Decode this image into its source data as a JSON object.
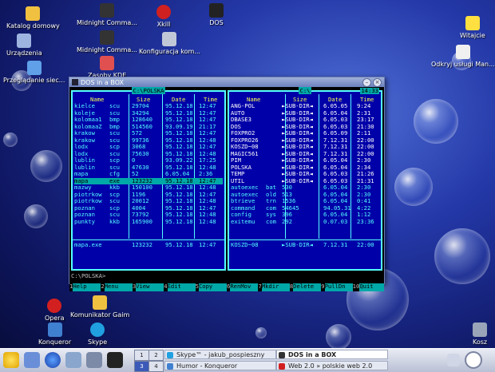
{
  "desktop": {
    "icons": [
      {
        "label": "Katalog domowy",
        "icon": "home-icon"
      },
      {
        "label": "Urządzenia",
        "icon": "computer-icon"
      },
      {
        "label": "Przeglądanie siec...",
        "icon": "network-icon"
      },
      {
        "label": "Midnight Comma...",
        "icon": "terminal-icon"
      },
      {
        "label": "Midnight Comma...",
        "icon": "terminal-icon"
      },
      {
        "label": "Zasoby KDE",
        "icon": "kde-resources-icon"
      },
      {
        "label": "Xkill",
        "icon": "xkill-icon"
      },
      {
        "label": "Konfiguracja kom...",
        "icon": "settings-icon"
      },
      {
        "label": "DOS",
        "icon": "dos-icon"
      },
      {
        "label": "Witajcie",
        "icon": "star-icon"
      },
      {
        "label": "Odkryj usługi Man...",
        "icon": "mandriva-icon"
      },
      {
        "label": "Opera",
        "icon": "opera-icon"
      },
      {
        "label": "Komunikator Gaim",
        "icon": "gaim-icon"
      },
      {
        "label": "Konqueror",
        "icon": "konqueror-icon"
      },
      {
        "label": "Skype",
        "icon": "skype-icon"
      },
      {
        "label": "Kosz",
        "icon": "trash-icon"
      }
    ]
  },
  "window": {
    "title": "DOS in a BOX",
    "buttons": [
      "minimize",
      "close"
    ]
  },
  "left_panel": {
    "path": "C:\\POLSKA",
    "headers": [
      "Name",
      "Size",
      "Date",
      "Time"
    ],
    "rows": [
      {
        "name": "kielce",
        "ext": "scu",
        "size": "29704",
        "date": "95.12.18",
        "time": "12:47"
      },
      {
        "name": "koleje",
        "ext": "scu",
        "size": "34294",
        "date": "95.12.18",
        "time": "12:47"
      },
      {
        "name": "kolomaa1",
        "ext": "bmp",
        "size": "128640",
        "date": "95.12.18",
        "time": "12:47"
      },
      {
        "name": "kolomaaZ",
        "ext": "bmp",
        "size": "514560",
        "date": "93.09.19",
        "time": "21:17"
      },
      {
        "name": "krakow",
        "ext": "scu",
        "size": "572",
        "date": "95.12.18",
        "time": "12:47"
      },
      {
        "name": "krakow",
        "ext": "scu",
        "size": "99736",
        "date": "95.12.18",
        "time": "12:48"
      },
      {
        "name": "lodx",
        "ext": "scp",
        "size": "3068",
        "date": "95.12.18",
        "time": "12:47"
      },
      {
        "name": "lodx",
        "ext": "scu",
        "size": "75630",
        "date": "95.12.18",
        "time": "12:48"
      },
      {
        "name": "lublin",
        "ext": "scp",
        "size": "0",
        "date": "93.09.22",
        "time": "17:25"
      },
      {
        "name": "lublin",
        "ext": "scu",
        "size": "47630",
        "date": "95.12.18",
        "time": "12:48"
      },
      {
        "name": "mapa",
        "ext": "cfg",
        "size": "52",
        "date": "6.05.04",
        "time": "2:36"
      },
      {
        "name": "mapa",
        "ext": "exe",
        "size": "123232",
        "date": "95.12.18",
        "time": "12:47",
        "selected": true
      },
      {
        "name": "mazwy",
        "ext": "kkb",
        "size": "150100",
        "date": "95.12.18",
        "time": "12:48"
      },
      {
        "name": "piotrkow",
        "ext": "scp",
        "size": "1196",
        "date": "95.12.18",
        "time": "12:47"
      },
      {
        "name": "piotrkow",
        "ext": "scu",
        "size": "20012",
        "date": "95.12.18",
        "time": "12:48"
      },
      {
        "name": "poznan",
        "ext": "scp",
        "size": "4004",
        "date": "95.12.18",
        "time": "12:47"
      },
      {
        "name": "poznan",
        "ext": "scu",
        "size": "73792",
        "date": "95.12.18",
        "time": "12:48"
      },
      {
        "name": "punkty",
        "ext": "kkb",
        "size": "165900",
        "date": "95.12.18",
        "time": "12:48"
      }
    ],
    "info": {
      "name": "mapa.exe",
      "size": "123232",
      "date": "95.12.18",
      "time": "12:47"
    }
  },
  "right_panel": {
    "path": "C:\\",
    "clock": "14:33",
    "headers": [
      "Name",
      "Size",
      "Date",
      "Time"
    ],
    "rows": [
      {
        "name": "ANG-POL",
        "ext": "",
        "size": "►SUB-DIR◄",
        "date": "6.05.05",
        "time": "9:24",
        "dir": true
      },
      {
        "name": "AUTO",
        "ext": "",
        "size": "►SUB-DIR◄",
        "date": "6.05.04",
        "time": "2:31",
        "dir": true
      },
      {
        "name": "DBASE3",
        "ext": "",
        "size": "►SUB-DIR◄",
        "date": "6.05.03",
        "time": "23:17",
        "dir": true
      },
      {
        "name": "DOS",
        "ext": "",
        "size": "►SUB-DIR◄",
        "date": "6.05.03",
        "time": "21:30",
        "dir": true
      },
      {
        "name": "FOXPRO2",
        "ext": "",
        "size": "►SUB-DIR◄",
        "date": "6.05.09",
        "time": "2:11",
        "dir": true
      },
      {
        "name": "FOXPRO26",
        "ext": "",
        "size": "►SUB-DIR◄",
        "date": "7.12.31",
        "time": "22:00",
        "dir": true
      },
      {
        "name": "KOSZD~08",
        "ext": "",
        "size": "►SUB-DIR◄",
        "date": "7.12.31",
        "time": "22:00",
        "dir": true
      },
      {
        "name": "MAGIC561",
        "ext": "",
        "size": "►SUB-DIR◄",
        "date": "7.12.31",
        "time": "22:00",
        "dir": true
      },
      {
        "name": "PIM",
        "ext": "",
        "size": "►SUB-DIR◄",
        "date": "6.05.04",
        "time": "2:30",
        "dir": true
      },
      {
        "name": "POLSKA",
        "ext": "",
        "size": "►SUB-DIR◄",
        "date": "6.05.04",
        "time": "2:34",
        "dir": true
      },
      {
        "name": "TEMP",
        "ext": "",
        "size": "►SUB-DIR◄",
        "date": "6.05.03",
        "time": "21:26",
        "dir": true
      },
      {
        "name": "UTIL",
        "ext": "",
        "size": "►SUB-DIR◄",
        "date": "6.05.03",
        "time": "21:31",
        "dir": true
      },
      {
        "name": "autoexec",
        "ext": "bat",
        "size": "530",
        "date": "6.05.04",
        "time": "2:30"
      },
      {
        "name": "autoexec",
        "ext": "old",
        "size": "513",
        "date": "6.05.04",
        "time": "2:30"
      },
      {
        "name": "btrieve",
        "ext": "trn",
        "size": "1536",
        "date": "6.05.04",
        "time": "0:41"
      },
      {
        "name": "command",
        "ext": "com",
        "size": "54645",
        "date": "94.05.31",
        "time": "4:22"
      },
      {
        "name": "config",
        "ext": "sys",
        "size": "396",
        "date": "6.05.04",
        "time": "1:12"
      },
      {
        "name": "exitemu",
        "ext": "com",
        "size": "292",
        "date": "0.07.03",
        "time": "23:36"
      }
    ],
    "info": {
      "name": "KOSZD~08",
      "size": "►SUB-DIR◄",
      "date": "7.12.31",
      "time": "22:00"
    }
  },
  "prompt": "C:\\POLSKA>",
  "fkeys": [
    {
      "n": "1",
      "label": "Help"
    },
    {
      "n": "2",
      "label": "Menu"
    },
    {
      "n": "3",
      "label": "View"
    },
    {
      "n": "4",
      "label": "Edit"
    },
    {
      "n": "5",
      "label": "Copy"
    },
    {
      "n": "6",
      "label": "RenMov"
    },
    {
      "n": "7",
      "label": "Mkdir"
    },
    {
      "n": "8",
      "label": "Delete"
    },
    {
      "n": "9",
      "label": "PullDn"
    },
    {
      "n": "10",
      "label": "Quit"
    }
  ],
  "taskbar": {
    "pager": [
      "1",
      "2",
      "3",
      "4"
    ],
    "tasks": [
      {
        "label": "Skype™ - jakub_pospieszny",
        "icon": "skype-icon"
      },
      {
        "label": "DOS in a BOX",
        "icon": "xwindow-icon",
        "active": true
      },
      {
        "label": "Humor - Konqueror",
        "icon": "konqueror-icon"
      },
      {
        "label": "Web 2.0 » polskie web 2.0",
        "icon": "opera-icon"
      }
    ]
  },
  "colors": {
    "panel_bg": "#0000a8",
    "panel_text": "#55ffff",
    "header_text": "#ffff55",
    "selection": "#00a8a8"
  }
}
